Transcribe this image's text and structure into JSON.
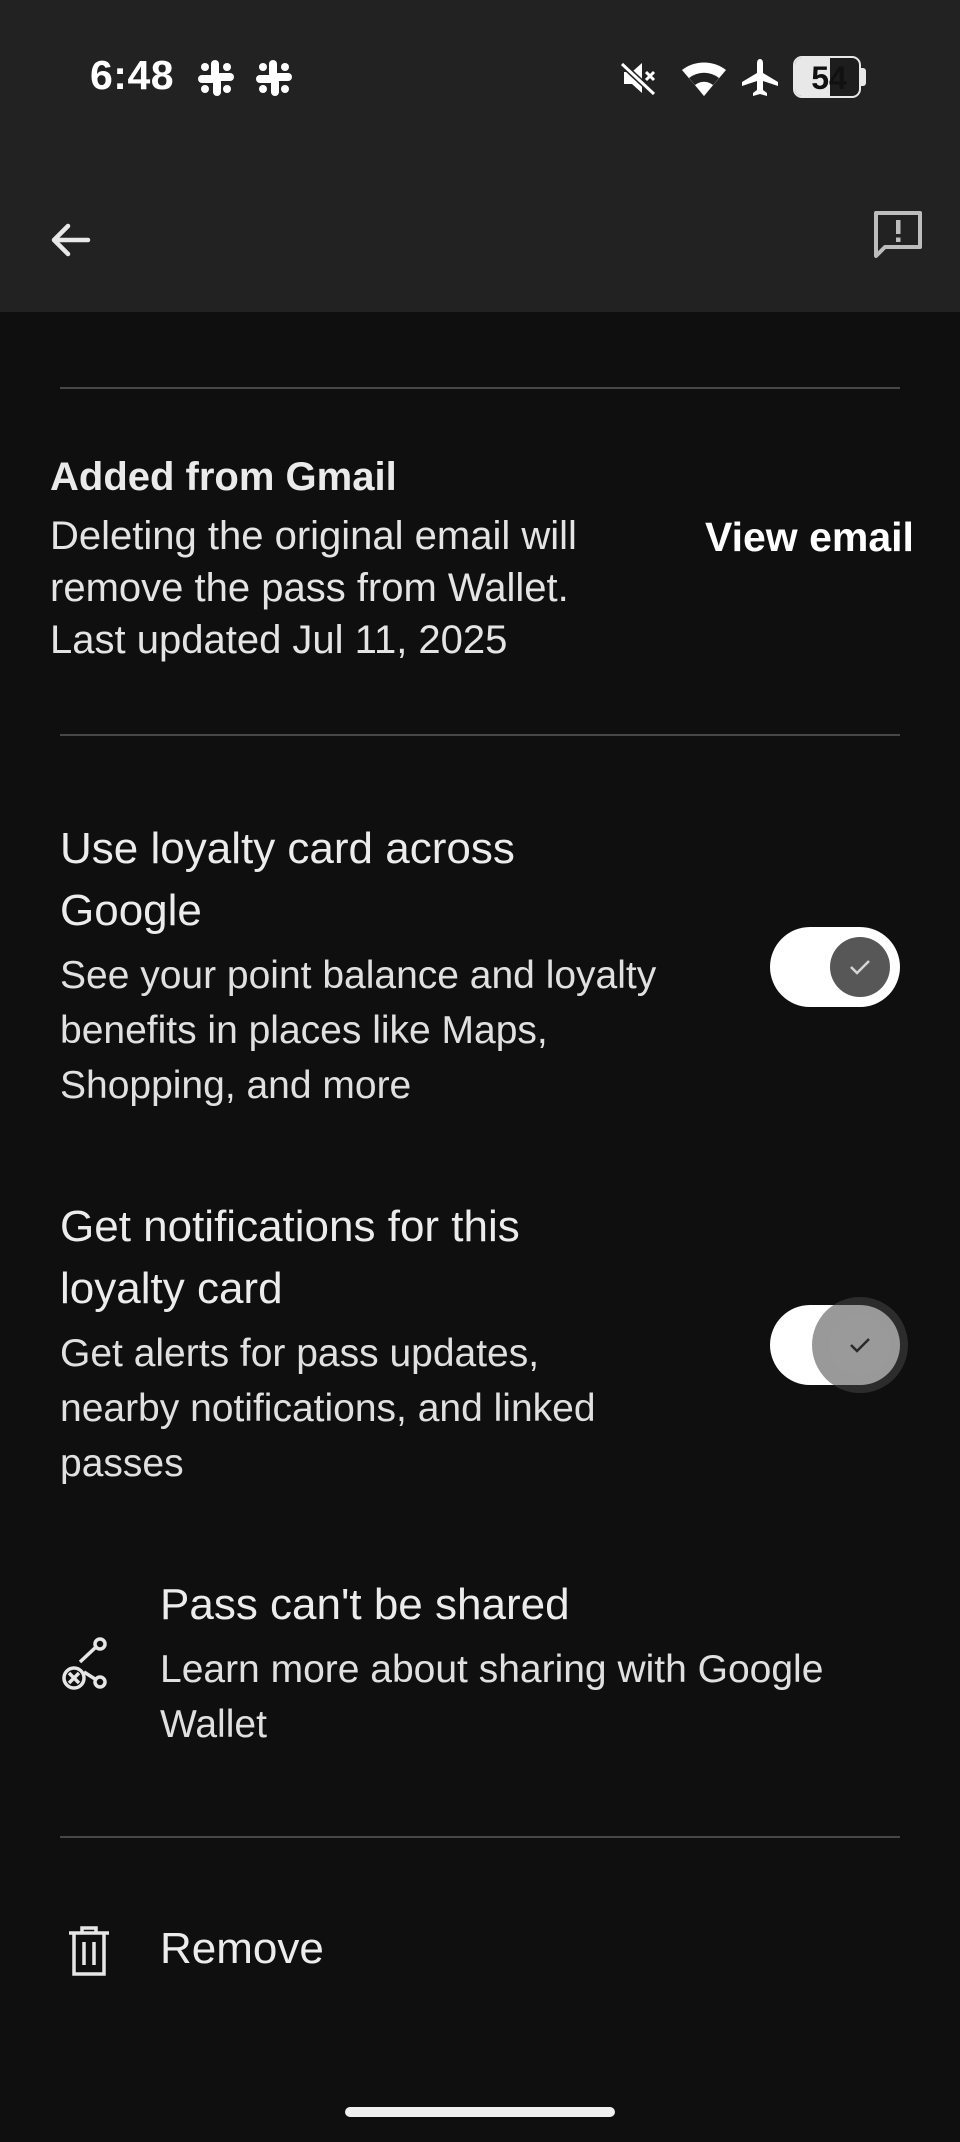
{
  "status_bar": {
    "time": "6:48",
    "notification_icons": [
      "slack-icon",
      "slack-icon"
    ],
    "system_icons": [
      "mute-icon",
      "wifi-icon",
      "airplane-icon"
    ],
    "battery_level": "54",
    "battery_fraction": 0.54
  },
  "toolbar": {
    "back_icon": "arrow-back-icon",
    "feedback_icon": "feedback-icon"
  },
  "source": {
    "title": "Added from Gmail",
    "description_lines": [
      "Deleting the original email will",
      "remove the pass from Wallet.",
      "Last updated Jul 11, 2025"
    ],
    "action_label": "View email"
  },
  "settings": [
    {
      "title_lines": [
        "Use loyalty card across",
        "Google"
      ],
      "description_lines": [
        "See your point balance and loyalty",
        "benefits in places like Maps,",
        "Shopping, and more"
      ],
      "enabled": true
    },
    {
      "title_lines": [
        "Get notifications for this",
        "loyalty card"
      ],
      "description_lines": [
        "Get alerts for pass updates,",
        "nearby notifications, and linked",
        "passes"
      ],
      "enabled": true
    }
  ],
  "sharing": {
    "icon": "share-off-icon",
    "title": "Pass can't be shared",
    "description_lines": [
      "Learn more about sharing with Google",
      "Wallet"
    ]
  },
  "remove": {
    "icon": "trash-icon",
    "label": "Remove"
  }
}
